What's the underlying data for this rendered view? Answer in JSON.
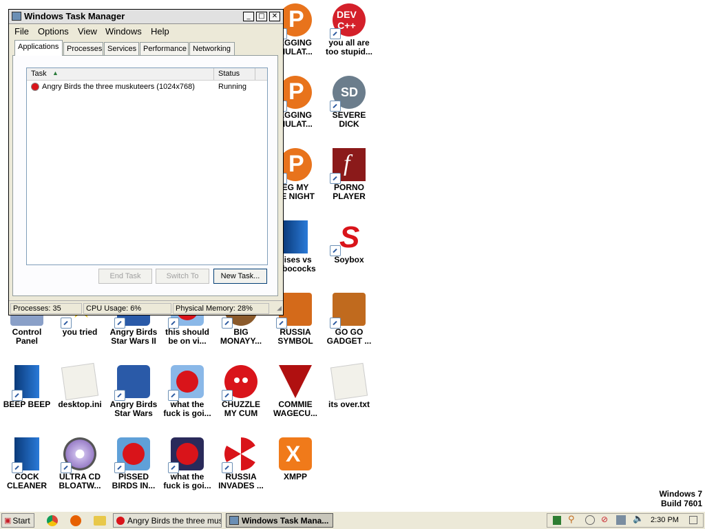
{
  "desktop": {
    "icons": [
      {
        "label": "EGGING\nMULAT...",
        "icon": "p-app-icon",
        "bg": "#e8731c"
      },
      {
        "label": "you all are\ntoo stupid...",
        "icon": "dev-cpp-icon",
        "bg": "#d4202a"
      },
      {
        "label": "EGGING\nMULAT...",
        "icon": "p-app-icon",
        "bg": "#e8731c"
      },
      {
        "label": "SEVERE\nDICK",
        "icon": "sd-gear-icon",
        "bg": "#6b7d8c"
      },
      {
        "label": "EG MY\nFE NIGHT",
        "icon": "p-app-icon",
        "bg": "#e8731c"
      },
      {
        "label": "PORNO\nPLAYER",
        "icon": "flash-icon",
        "bg": "#8b1a1a"
      },
      {
        "label": "nises vs\nmbococks",
        "icon": "blue-book-icon",
        "bg": "#1e5aa8"
      },
      {
        "label": "Soybox",
        "icon": "s-logo-icon",
        "bg": "#d9141a"
      },
      {
        "label": "Control\nPanel",
        "icon": "control-panel-icon",
        "bg": "#8aa0c8"
      },
      {
        "label": "you tried",
        "icon": "star-icon",
        "bg": "#e8c21a"
      },
      {
        "label": "Angry Birds\nStar Wars II",
        "icon": "angry-birds-icon",
        "bg": "#2a5aa8"
      },
      {
        "label": "this should\nbe on vi...",
        "icon": "angry-bird-icon",
        "bg": "#d9141a"
      },
      {
        "label": "BIG\nMONAYY...",
        "icon": "money-icon",
        "bg": "#8b5a2b"
      },
      {
        "label": "RUSSIA\nSYMBOL",
        "icon": "russia-symbol-icon",
        "bg": "#d46a1a"
      },
      {
        "label": "GO GO\nGADGET ...",
        "icon": "briefcase-icon",
        "bg": "#c06a1e"
      },
      {
        "label": "BEEP BEEP",
        "icon": "blue-book-icon",
        "bg": "#1e5aa8"
      },
      {
        "label": "desktop.ini",
        "icon": "ini-file-icon",
        "bg": "#e8e8e0"
      },
      {
        "label": "Angry Birds\nStar Wars",
        "icon": "angry-birds-icon",
        "bg": "#2a5aa8"
      },
      {
        "label": "what the\nfuck is goi...",
        "icon": "angry-bird-icon",
        "bg": "#d9141a"
      },
      {
        "label": "CHUZZLE\nMY CUM",
        "icon": "chuzzle-icon",
        "bg": "#d9141a"
      },
      {
        "label": "COMMIE\nWAGECU...",
        "icon": "commie-icon",
        "bg": "#b01010"
      },
      {
        "label": "its over.txt",
        "icon": "txt-file-icon",
        "bg": "#f0efe6"
      },
      {
        "label": "COCK\nCLEANER",
        "icon": "blue-book-icon",
        "bg": "#1e5aa8"
      },
      {
        "label": "ULTRA CD\nBLOATW...",
        "icon": "cd-icon",
        "bg": "#9a7fc8"
      },
      {
        "label": "PISSED\nBIRDS IN...",
        "icon": "angry-bird-icon",
        "bg": "#5fa0d8"
      },
      {
        "label": "what the\nfuck is goi...",
        "icon": "angry-bird-space-icon",
        "bg": "#2a2a5a"
      },
      {
        "label": "RUSSIA\nINVADES ...",
        "icon": "radiation-icon",
        "bg": "#d9141a"
      },
      {
        "label": "XMPP",
        "icon": "xampp-icon",
        "bg": "#f07a1a"
      }
    ],
    "watermark": {
      "line1": "Windows 7",
      "line2": "Build 7601"
    }
  },
  "task_manager": {
    "title": "Windows Task Manager",
    "menu": [
      "File",
      "Options",
      "View",
      "Windows",
      "Help"
    ],
    "tabs": [
      "Applications",
      "Processes",
      "Services",
      "Performance",
      "Networking"
    ],
    "active_tab": "Applications",
    "columns": [
      "Task",
      "Status"
    ],
    "rows": [
      {
        "task": "Angry Birds the three muskuteers (1024x768)",
        "status": "Running"
      }
    ],
    "buttons": {
      "end_task": "End Task",
      "switch_to": "Switch To",
      "new_task": "New Task..."
    },
    "status": {
      "processes": "Processes: 35",
      "cpu": "CPU Usage: 6%",
      "memory": "Physical Memory: 28%"
    }
  },
  "taskbar": {
    "start_label": "Start",
    "buttons": [
      {
        "label": "Angry Birds the three mus..."
      },
      {
        "label": "Windows Task Mana..."
      }
    ],
    "clock": "2:30 PM"
  }
}
